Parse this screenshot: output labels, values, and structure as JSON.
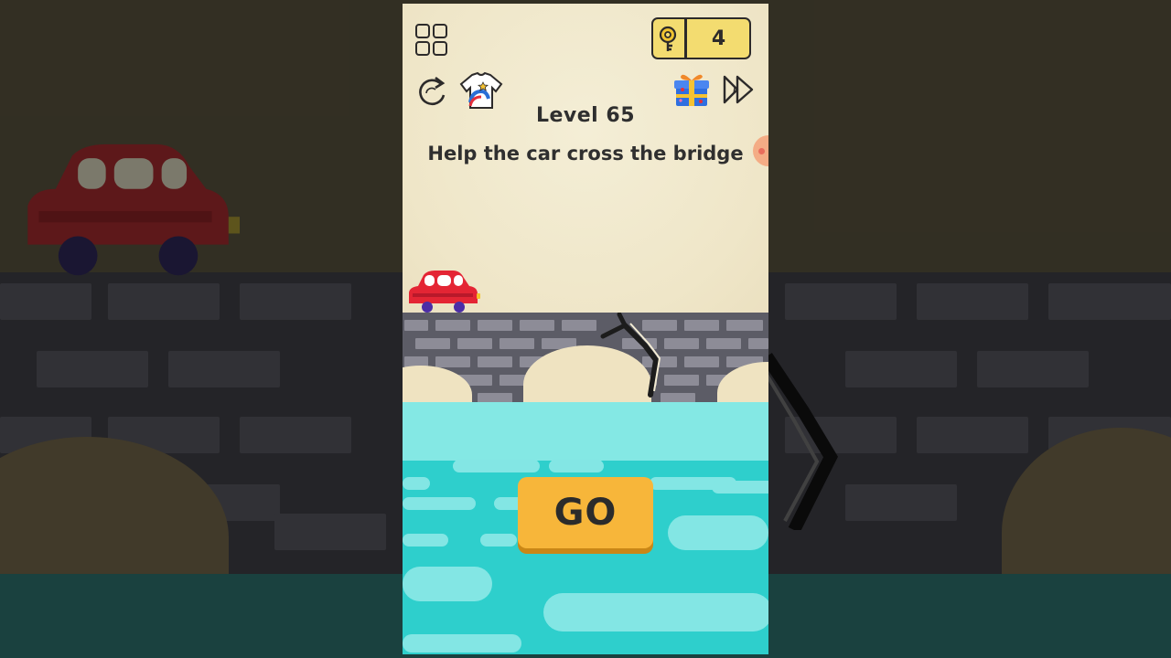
{
  "level": {
    "title": "Level 65",
    "hint": "Help the car cross the bridge"
  },
  "keys": {
    "count": "4",
    "icon": "key-icon"
  },
  "toolbar": {
    "menu_icon": "grid-menu-icon",
    "restart_icon": "restart-icon",
    "shop_icon": "shirt-icon",
    "gift_icon": "gift-icon",
    "skip_icon": "skip-icon"
  },
  "action": {
    "go_label": "GO"
  },
  "colors": {
    "paper": "#f1e9cf",
    "bridge_dark": "#5c5c66",
    "bridge_brick": "#8d8c97",
    "water": "#2ecfcc",
    "water_light": "#84e8e4",
    "go_button": "#f7b63a",
    "key_badge": "#f3dc70",
    "car_body": "#e42534",
    "text": "#2f2f2f"
  }
}
